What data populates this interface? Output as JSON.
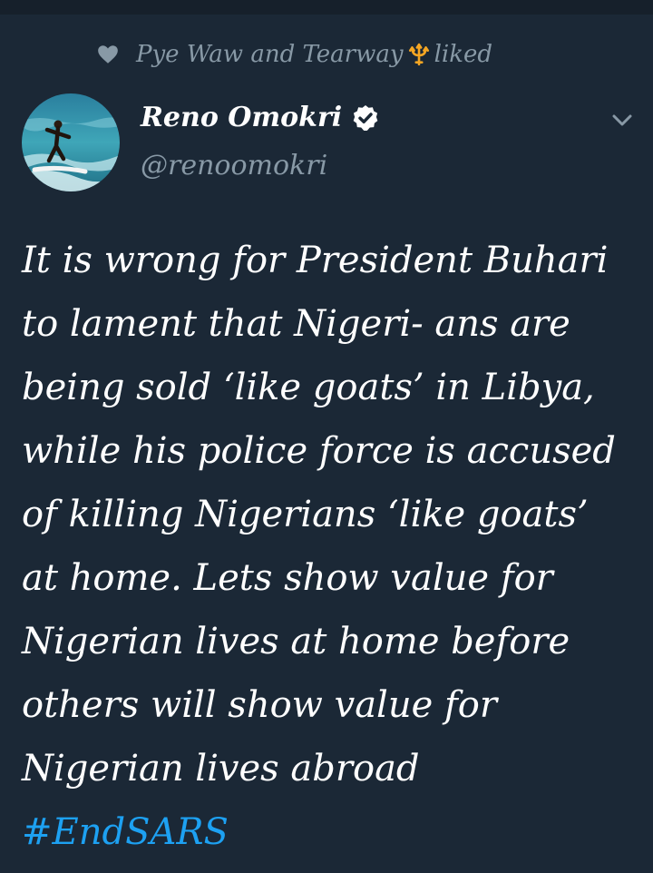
{
  "social_context": {
    "text": "Pye Waw and Tearway",
    "suffix": "liked",
    "icon": "heart-icon",
    "emoji": "trident-emoji"
  },
  "author": {
    "name": "Reno Omokri",
    "handle": "@renoomokri",
    "verified": true
  },
  "tweet": {
    "text": "It is wrong for President Buhari to lament that Nigeri- ans are being sold ‘like goats’ in Libya, while his police force is accused of killing Nigerians ‘like goats’ at home. Lets show value for Nigerian lives at home before others will show value for Nigerian lives abroad ",
    "hashtag": "#EndSARS"
  },
  "colors": {
    "background": "#1b2836",
    "text": "#ffffff",
    "muted": "#8899a6",
    "link": "#1da1f2"
  }
}
